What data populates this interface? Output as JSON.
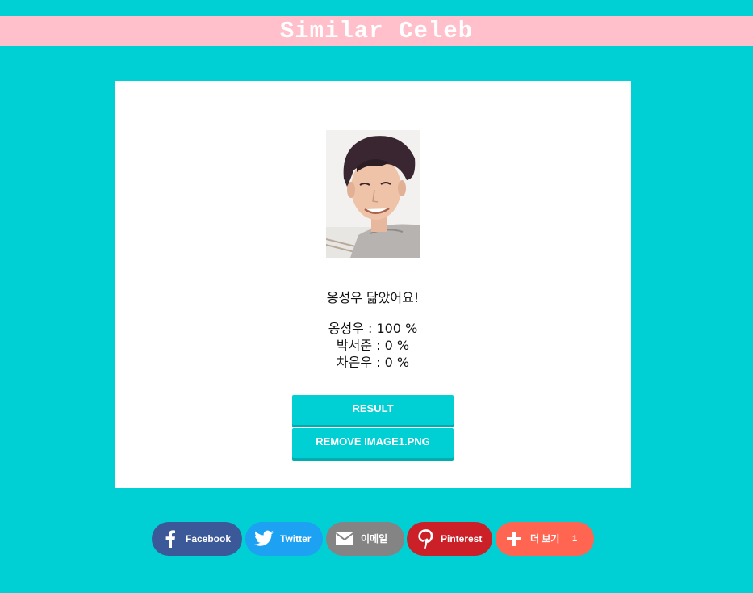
{
  "header": {
    "title": "Similar Celeb"
  },
  "result": {
    "heading": "옹성우 닮았어요!",
    "scores": [
      {
        "text": "옹성우 : 100 %",
        "name": "옹성우",
        "percent": 100
      },
      {
        "text": "박서준 : 0 %",
        "name": "박서준",
        "percent": 0
      },
      {
        "text": "차은우 : 0 %",
        "name": "차은우",
        "percent": 0
      }
    ]
  },
  "buttons": {
    "result_label": "RESULT",
    "remove_label": "REMOVE IMAGE1.PNG"
  },
  "share": {
    "facebook": {
      "label": "Facebook",
      "icon": "facebook-icon",
      "color": "#3b5998"
    },
    "twitter": {
      "label": "Twitter",
      "icon": "twitter-icon",
      "color": "#1da1f2"
    },
    "email": {
      "label": "이메일",
      "icon": "email-icon",
      "color": "#848484"
    },
    "pinterest": {
      "label": "Pinterest",
      "icon": "pinterest-icon",
      "color": "#cb2027"
    },
    "more": {
      "label": "더 보기",
      "count": "1",
      "icon": "plus-icon",
      "color": "#ff6550"
    }
  },
  "colors": {
    "background": "#00cfd4",
    "header": "#ffc0cb",
    "card": "#ffffff",
    "button": "#00cfd4"
  }
}
